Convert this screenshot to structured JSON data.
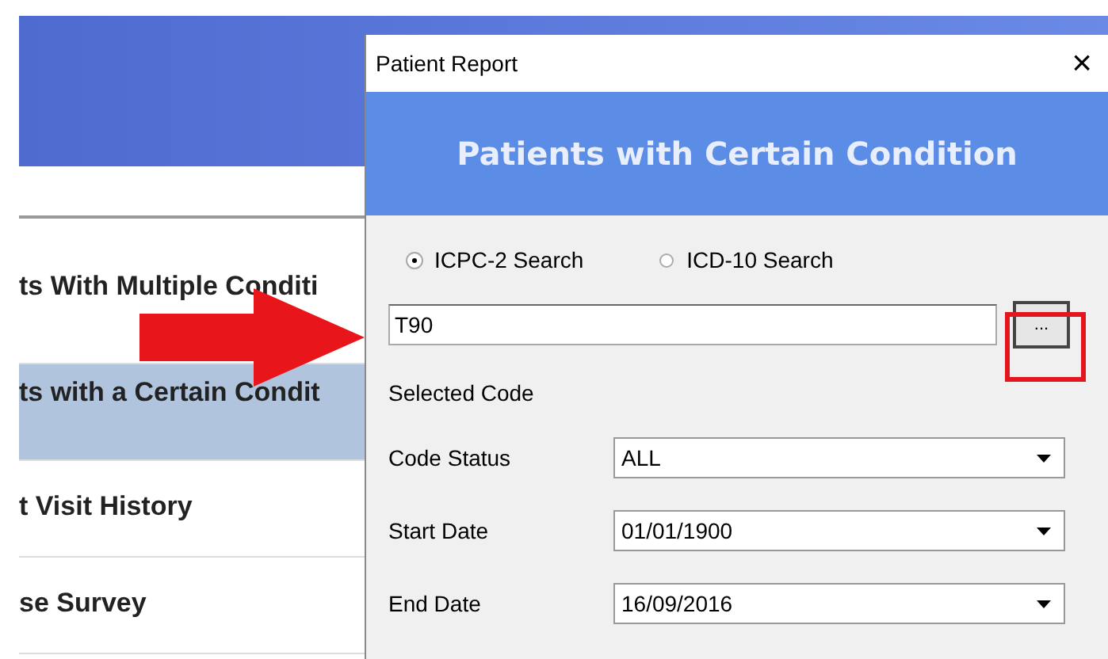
{
  "report_list": [
    {
      "label": "ts With Multiple Conditi",
      "selected": false
    },
    {
      "label": "ts with a Certain Condit",
      "selected": true
    },
    {
      "label": "t Visit History",
      "selected": false
    },
    {
      "label": "se Survey",
      "selected": false
    }
  ],
  "dialog": {
    "title": "Patient Report",
    "close": "×",
    "banner": "Patients with Certain Condition",
    "search_options": [
      {
        "label": "ICPC-2 Search",
        "selected": true
      },
      {
        "label": "ICD-10 Search",
        "selected": false
      }
    ],
    "code_field": {
      "value": "T90"
    },
    "browse_button": "...",
    "selected_code_label": "Selected Code",
    "fields": [
      {
        "label": "Code Status",
        "value": "ALL"
      },
      {
        "label": "Start Date",
        "value": "01/01/1900"
      },
      {
        "label": "End Date",
        "value": "16/09/2016"
      }
    ]
  }
}
